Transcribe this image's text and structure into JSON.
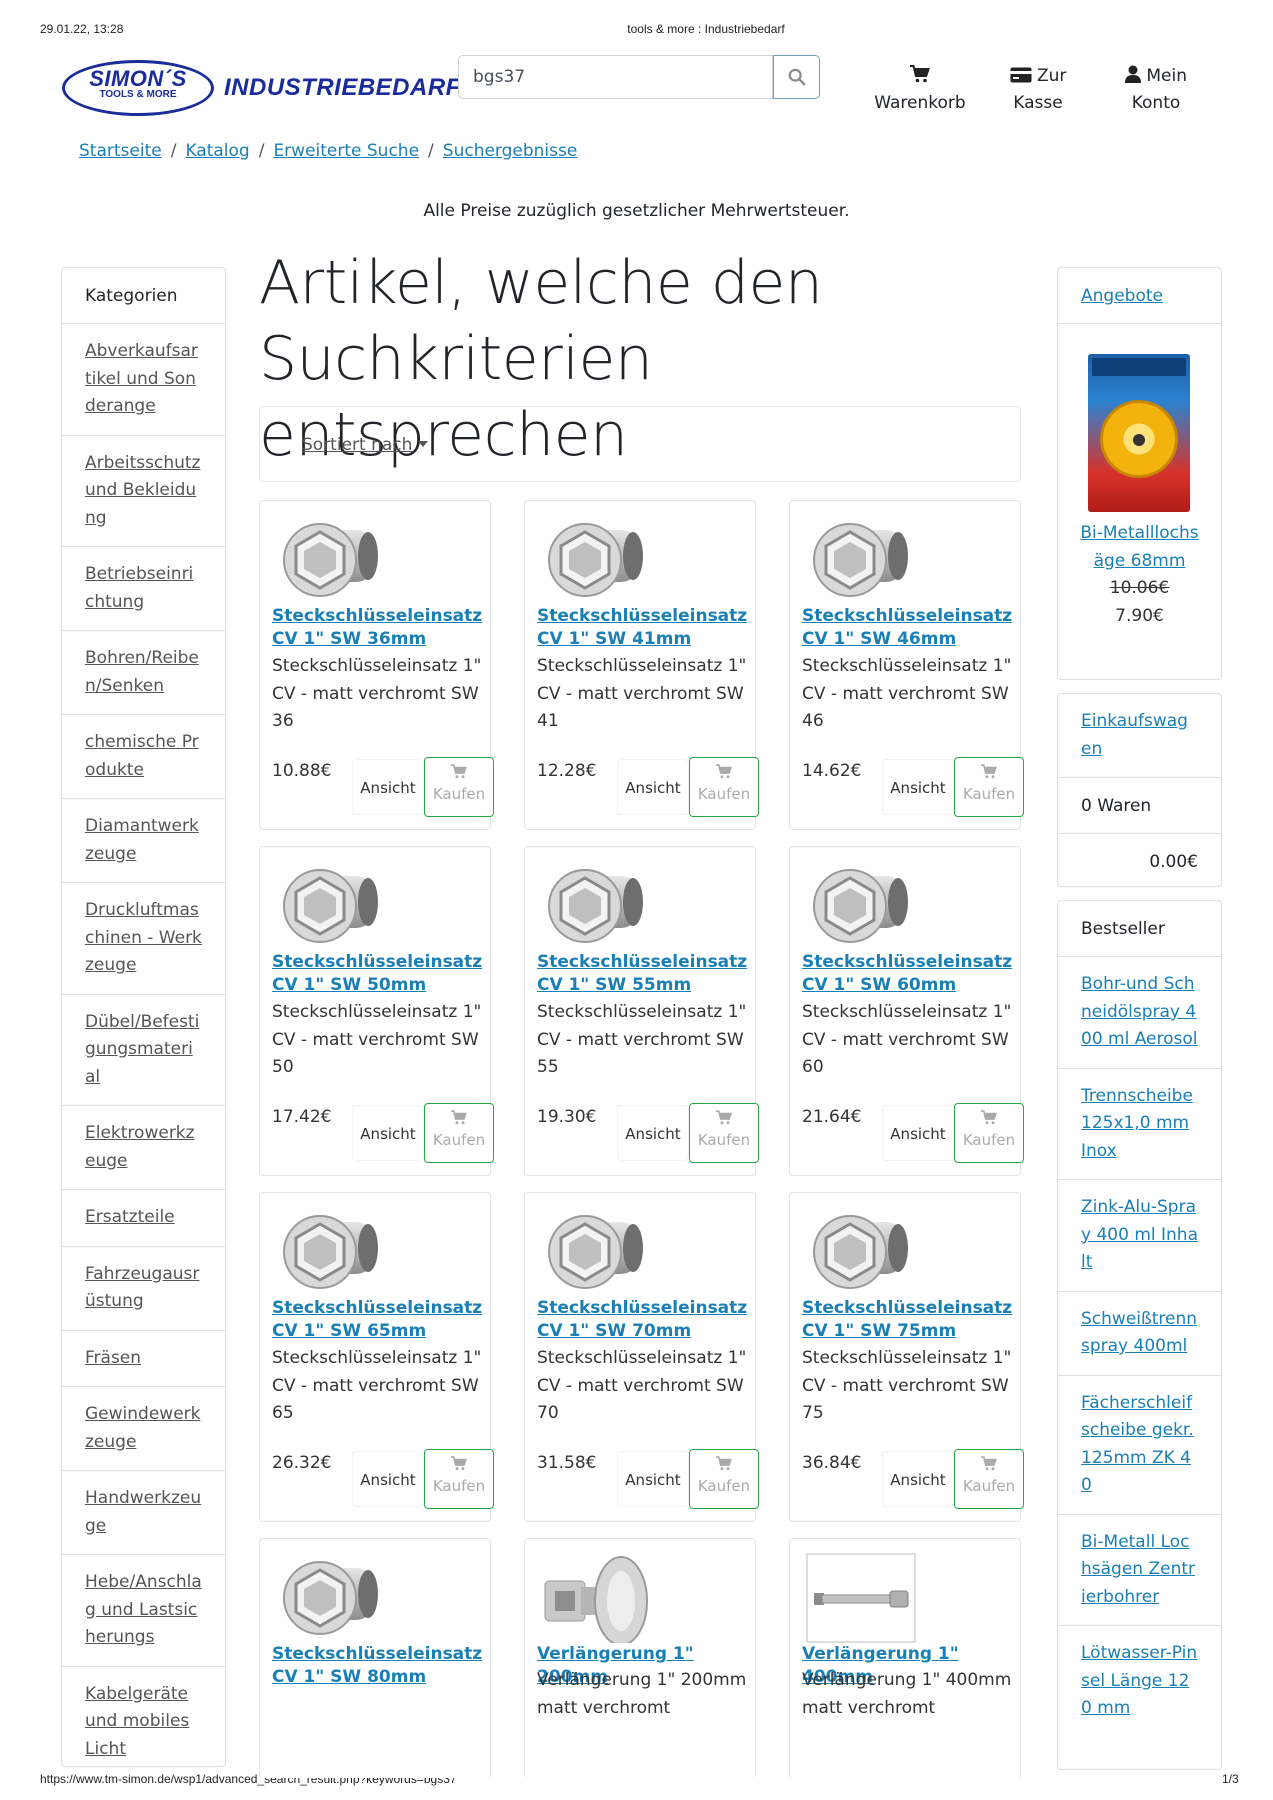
{
  "print_header": {
    "datetime": "29.01.22, 13:28",
    "title": "tools & more : Industriebedarf"
  },
  "print_footer": {
    "url": "https://www.tm-simon.de/wsp1/advanced_search_result.php?keywords=bgs37",
    "page": "1/3"
  },
  "logo": {
    "line1": "SIMON´S",
    "line2": "TOOLS & MORE",
    "word": "INDUSTRIEBEDARF"
  },
  "search": {
    "value": "bgs37"
  },
  "nav": {
    "cart_label": "Warenkorb",
    "checkout_line1": "Zur",
    "checkout_line2": "Kasse",
    "account_line1": "Mein",
    "account_line2": "Konto"
  },
  "breadcrumb": [
    "Startseite",
    "Katalog",
    "Erweiterte Suche",
    "Suchergebnisse"
  ],
  "vat_note": "Alle Preise zuzüglich gesetzlicher Mehrwertsteuer.",
  "categories": {
    "heading": "Kategorien",
    "items": [
      "Abverkaufsartikel und Sonderange",
      "Arbeitsschutz und Bekleidung",
      "Betriebseinrichtung",
      "Bohren/Reiben/Senken",
      "chemische Produkte",
      "Diamantwerkzeuge",
      "Druckluftmaschinen - Werkzeuge",
      "Dübel/Befestigungsmaterial",
      "Elektrowerkzeuge",
      "Ersatzteile",
      "Fahrzeugausrüstung",
      "Fräsen",
      "Gewindewerkzeuge",
      "Handwerkzeuge",
      "Hebe/Anschlag und Lastsicherungs",
      "Kabelgeräte und mobiles Licht"
    ]
  },
  "page_title": "Artikel, welche den Suchkriterien entsprechen",
  "sort_label": "Sortiert nach",
  "buttons": {
    "view": "Ansicht",
    "buy": "Kaufen"
  },
  "products": [
    {
      "title": "Steckschlüsseleinsatz CV 1\" SW 36mm",
      "desc": "Steckschlüsseleinsatz 1\" CV - matt verchromt SW 36",
      "price": "10.88€",
      "image": "socket"
    },
    {
      "title": "Steckschlüsseleinsatz CV 1\" SW 41mm",
      "desc": "Steckschlüsseleinsatz 1\" CV - matt verchromt SW 41",
      "price": "12.28€",
      "image": "socket"
    },
    {
      "title": "Steckschlüsseleinsatz CV 1\" SW 46mm",
      "desc": "Steckschlüsseleinsatz 1\" CV - matt verchromt SW 46",
      "price": "14.62€",
      "image": "socket"
    },
    {
      "title": "Steckschlüsseleinsatz CV 1\" SW 50mm",
      "desc": "Steckschlüsseleinsatz 1\" CV - matt verchromt SW 50",
      "price": "17.42€",
      "image": "socket"
    },
    {
      "title": "Steckschlüsseleinsatz CV 1\" SW 55mm",
      "desc": "Steckschlüsseleinsatz 1\" CV - matt verchromt SW 55",
      "price": "19.30€",
      "image": "socket"
    },
    {
      "title": "Steckschlüsseleinsatz CV 1\" SW 60mm",
      "desc": "Steckschlüsseleinsatz 1\" CV - matt verchromt SW 60",
      "price": "21.64€",
      "image": "socket"
    },
    {
      "title": "Steckschlüsseleinsatz CV 1\" SW 65mm",
      "desc": "Steckschlüsseleinsatz 1\" CV - matt verchromt SW 65",
      "price": "26.32€",
      "image": "socket"
    },
    {
      "title": "Steckschlüsseleinsatz CV 1\" SW 70mm",
      "desc": "Steckschlüsseleinsatz 1\" CV - matt verchromt SW 70",
      "price": "31.58€",
      "image": "socket"
    },
    {
      "title": "Steckschlüsseleinsatz CV 1\" SW 75mm",
      "desc": "Steckschlüsseleinsatz 1\" CV - matt verchromt SW 75",
      "price": "36.84€",
      "image": "socket"
    },
    {
      "title": "Steckschlüsseleinsatz CV 1\" SW 80mm",
      "desc": "",
      "price": "",
      "image": "socket"
    },
    {
      "title": "Verlängerung 1\" 200mm",
      "desc": "Verlängerung 1\" 200mm matt verchromt",
      "price": "",
      "image": "extension-short"
    },
    {
      "title": "Verlängerung 1\" 400mm",
      "desc": "Verlängerung 1\" 400mm matt verchromt",
      "price": "",
      "image": "extension-long"
    }
  ],
  "offers": {
    "heading": "Angebote",
    "product": "Bi-Metalllochsäge 68mm",
    "old_price": "10.06€",
    "new_price": "7.90€"
  },
  "cart_box": {
    "heading": "Einkaufswagen",
    "count": "0 Waren",
    "total": "0.00€"
  },
  "bestseller": {
    "heading": "Bestseller",
    "items": [
      "Bohr-und Schneidölspray 400 ml Aerosol",
      "Trennscheibe 125x1,0 mm Inox",
      "Zink-Alu-Spray 400 ml Inhalt",
      "Schweißtrennspray 400ml",
      "Fächerschleifscheibe gekr. 125mm ZK 40",
      "Bi-Metall Lochsägen Zentrierbohrer",
      "Lötwasser-Pinsel Länge 120 mm"
    ]
  },
  "colors": {
    "link": "#1a7fb5",
    "brand": "#1a2b9a",
    "buy_border": "#28a745"
  }
}
